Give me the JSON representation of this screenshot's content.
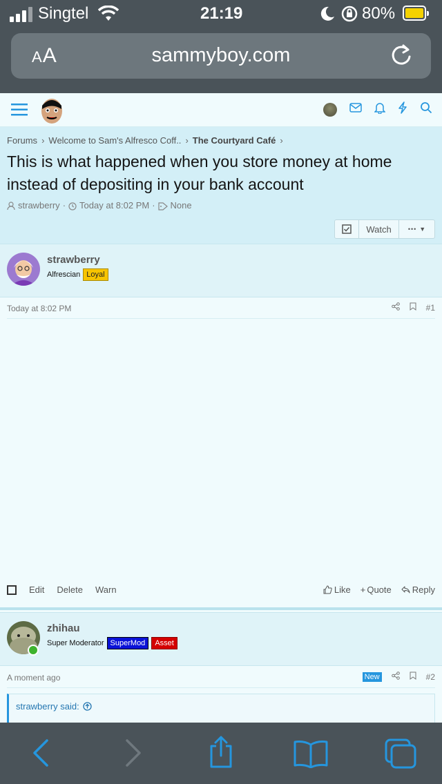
{
  "status": {
    "carrier": "Singtel",
    "time": "21:19",
    "battery": "80%"
  },
  "browser": {
    "aa_label_big": "A",
    "aa_label_small": "A",
    "url": "sammyboy.com"
  },
  "breadcrumb": {
    "forums": "Forums",
    "section": "Welcome to Sam's Alfresco Coff..",
    "forum": "The Courtyard Café"
  },
  "thread": {
    "title": "This is what happened when you store money at home instead of depositing in your bank account",
    "author": "strawberry",
    "date": "Today at 8:02 PM",
    "tags": "None",
    "watch_label": "Watch",
    "more_label": "•••"
  },
  "posts": [
    {
      "username": "strawberry",
      "user_title": "Alfrescian",
      "badges": [
        "Loyal"
      ],
      "date": "Today at 8:02 PM",
      "number": "#1",
      "actions": {
        "edit": "Edit",
        "delete": "Delete",
        "warn": "Warn"
      },
      "reactions": {
        "like": "Like",
        "quote": "Quote",
        "reply": "Reply"
      }
    },
    {
      "username": "zhihau",
      "user_title": "Super Moderator",
      "badges": [
        "SuperMod",
        "Asset"
      ],
      "date": "A moment ago",
      "new_label": "New",
      "number": "#2",
      "quote_label": "strawberry said:"
    }
  ],
  "colors": {
    "accent": "#2596de",
    "header_bg": "#d3eff7",
    "page_bg": "#f0fbfd",
    "chrome": "#4a5359"
  }
}
